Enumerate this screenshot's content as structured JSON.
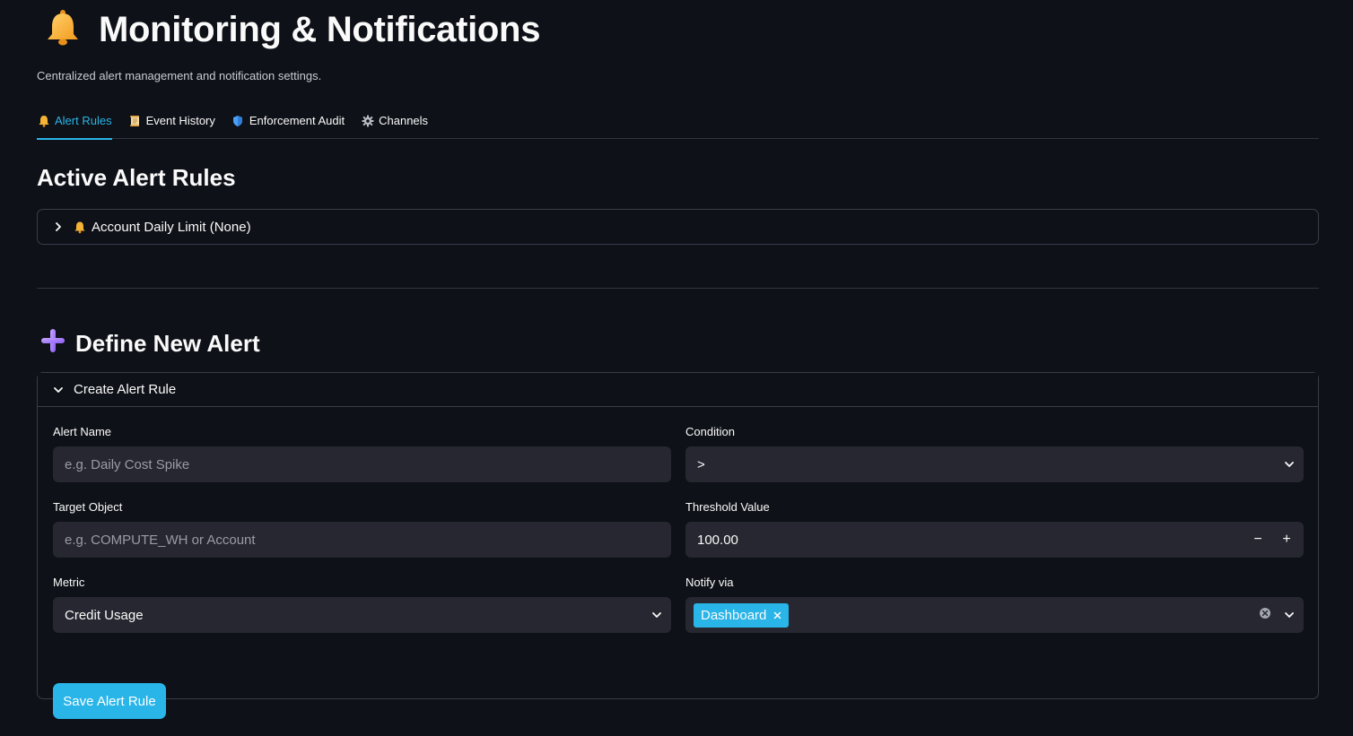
{
  "header": {
    "title": "Monitoring & Notifications",
    "subtitle": "Centralized alert management and notification settings."
  },
  "tabs": [
    {
      "label": "Alert Rules",
      "icon": "bell-icon",
      "active": true
    },
    {
      "label": "Event History",
      "icon": "scroll-icon",
      "active": false
    },
    {
      "label": "Enforcement Audit",
      "icon": "shield-icon",
      "active": false
    },
    {
      "label": "Channels",
      "icon": "gear-icon",
      "active": false
    }
  ],
  "active_rules": {
    "heading": "Active Alert Rules",
    "items": [
      {
        "label": "Account Daily Limit (None)",
        "icon": "bell-icon",
        "expanded": false
      }
    ]
  },
  "new_alert": {
    "heading": "Define New Alert",
    "expander_label": "Create Alert Rule",
    "alert_name": {
      "label": "Alert Name",
      "placeholder": "e.g. Daily Cost Spike",
      "value": ""
    },
    "condition": {
      "label": "Condition",
      "value": ">"
    },
    "target_object": {
      "label": "Target Object",
      "placeholder": "e.g. COMPUTE_WH or Account",
      "value": ""
    },
    "threshold": {
      "label": "Threshold Value",
      "value": "100.00",
      "minus": "−",
      "plus": "+"
    },
    "metric": {
      "label": "Metric",
      "value": "Credit Usage"
    },
    "notify_via": {
      "label": "Notify via",
      "selected": [
        "Dashboard"
      ]
    },
    "save_label": "Save Alert Rule"
  },
  "colors": {
    "background": "#0e1117",
    "accent": "#29b5e8",
    "input_bg": "#262730",
    "border": "#3a3d49"
  }
}
